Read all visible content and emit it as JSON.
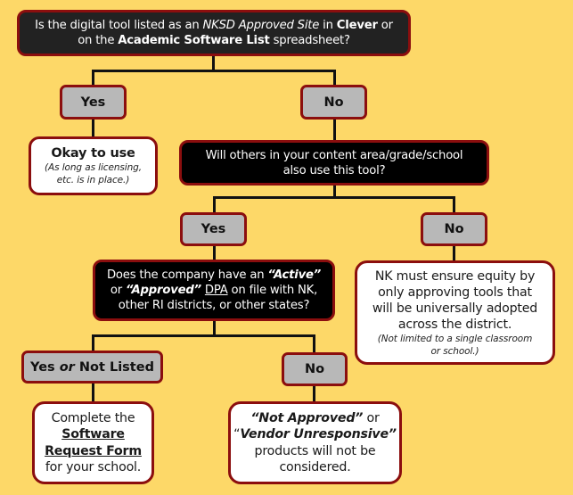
{
  "flowchart": {
    "q1": {
      "line1": {
        "before": "Is the digital tool listed as an ",
        "italic": "NKSD Approved Site",
        "middle": " in ",
        "bold": "Clever",
        "after": " or"
      },
      "line2": {
        "before": "on the ",
        "bold": "Academic Software List",
        "after": " spreadsheet?"
      }
    },
    "q1_yes": {
      "label": "Yes"
    },
    "q1_no": {
      "label": "No"
    },
    "okay": {
      "title": "Okay to use",
      "note_line1": "(As long as licensing,",
      "note_line2": "etc. is in place.)"
    },
    "q2": {
      "line1": "Will others in your content area/grade/school",
      "line2": "also use this tool?"
    },
    "q2_yes": {
      "label": "Yes"
    },
    "q2_no": {
      "label": "No"
    },
    "q3": {
      "line1": {
        "before": "Does the company have an ",
        "bold_italic": "“Active”"
      },
      "line2": {
        "before": "or ",
        "bold_italic": "“Approved”",
        "space": " ",
        "underline": "DPA",
        "after": " on file with NK,"
      },
      "line3": "other RI districts, or other states?"
    },
    "equity": {
      "line1": "NK must ensure equity by",
      "line2": "only approving tools that",
      "line3": "will be universally adopted",
      "line4": "across the district.",
      "note_line1": "(Not limited to a single classroom",
      "note_line2": "or school.)"
    },
    "q3_yes": {
      "yes": "Yes",
      "or": " or ",
      "not_listed": "Not Listed"
    },
    "q3_no": {
      "label": "No"
    },
    "complete": {
      "line1": "Complete the",
      "link_line1": "Software",
      "link_line2": "Request Form",
      "line4": "for your school."
    },
    "not_approved": {
      "bold_italic1": "“Not Approved”",
      "or": " or",
      "open_quote": "“",
      "bold_italic2": "Vendor Unresponsive”",
      "line3": "products will not be",
      "line4": "considered."
    }
  },
  "colors": {
    "background": "#FDD868",
    "border": "#8B0E0E",
    "answer_fill": "#B8B8B8",
    "question_fill_top": "#222222",
    "question_fill": "#000000",
    "outcome_fill": "#FFFFFF"
  }
}
